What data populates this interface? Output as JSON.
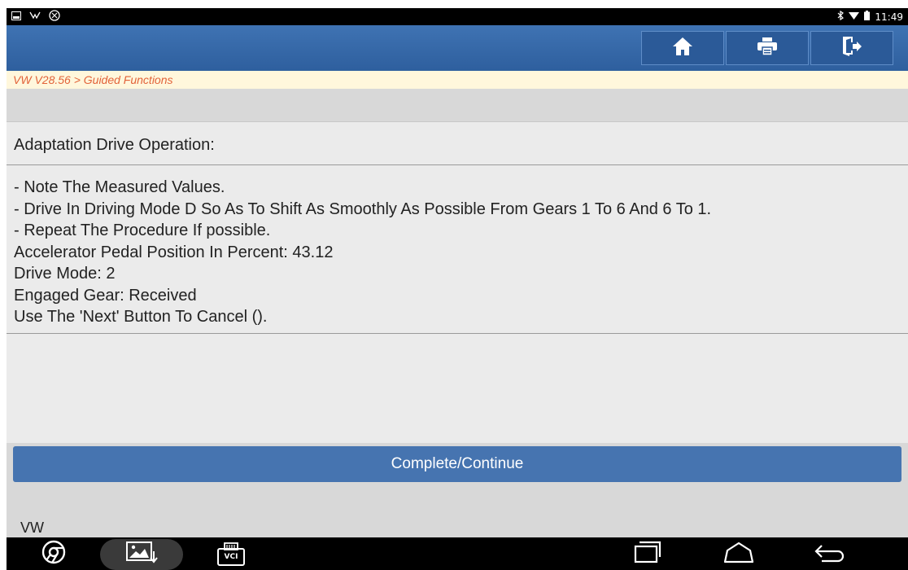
{
  "status_bar": {
    "left_icons": [
      "gallery-icon",
      "usb-debug-icon",
      "settings-alt-icon"
    ],
    "right_icons": [
      "bluetooth-icon",
      "wifi-icon",
      "battery-icon"
    ],
    "time": "11:49"
  },
  "toolbar": {
    "buttons": [
      {
        "name": "home",
        "icon": "home-icon"
      },
      {
        "name": "print",
        "icon": "print-icon"
      },
      {
        "name": "exit",
        "icon": "exit-icon"
      }
    ],
    "accent_color": "#3f73b3"
  },
  "breadcrumb": "VW V28.56 > Guided Functions",
  "panel": {
    "title": "Adaptation Drive Operation:",
    "lines": [
      "- Note The Measured Values.",
      "- Drive In Driving Mode D So As To Shift As Smoothly As Possible From Gears 1 To 6 And 6 To 1.",
      "- Repeat The Procedure If possible.",
      "Accelerator Pedal Position In Percent: 43.12",
      "Drive Mode: 2",
      "Engaged Gear: Received",
      "Use The 'Next' Button To Cancel ()."
    ]
  },
  "action_button": "Complete/Continue",
  "footer_label": "VW",
  "nav_bar": {
    "vci_label": "VCI",
    "items": [
      "chrome-icon",
      "screenshot-icon",
      "vci-icon",
      "recent-apps-icon",
      "home-nav-icon",
      "back-icon"
    ]
  }
}
